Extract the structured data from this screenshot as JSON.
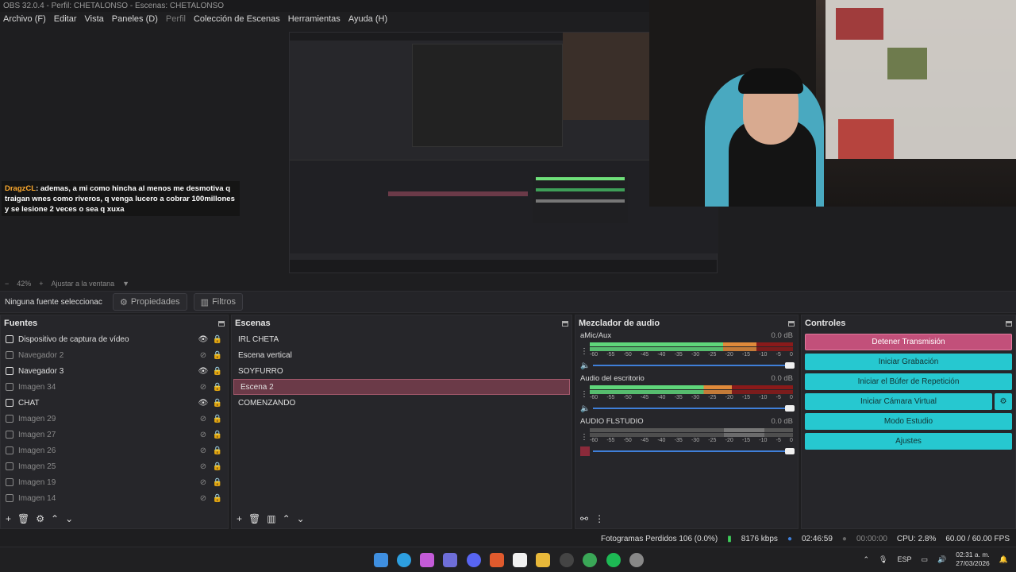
{
  "window": {
    "title": "OBS 32.0.4 - Perfil: CHETALONSO - Escenas: CHETALONSO"
  },
  "menu": [
    {
      "label": "Archivo (F)",
      "dim": false
    },
    {
      "label": "Editar",
      "dim": false
    },
    {
      "label": "Vista",
      "dim": false
    },
    {
      "label": "Paneles (D)",
      "dim": false
    },
    {
      "label": "Perfil",
      "dim": true
    },
    {
      "label": "Colección de Escenas",
      "dim": false
    },
    {
      "label": "Herramientas",
      "dim": false
    },
    {
      "label": "Ayuda (H)",
      "dim": false
    }
  ],
  "chat": {
    "user": "DragzCL",
    "message": ": ademas, a mi como hincha al menos me desmotiva q traigan wnes como riveros, q venga lucero a cobrar 100millones y se lesione 2 veces o sea q xuxa"
  },
  "zoom": {
    "minus": "−",
    "value": "42%",
    "plus": "+",
    "fit": "Ajustar a la ventana"
  },
  "propbar": {
    "no_source": "Ninguna fuente seleccionac",
    "properties": "Propiedades",
    "filters": "Filtros"
  },
  "sources": {
    "title": "Fuentes",
    "items": [
      {
        "name": "Dispositivo de captura de vídeo",
        "visible": true,
        "icon": "camera-icon"
      },
      {
        "name": "Navegador 2",
        "visible": false,
        "icon": "globe-icon"
      },
      {
        "name": "Navegador 3",
        "visible": true,
        "icon": "globe-icon"
      },
      {
        "name": "Imagen 34",
        "visible": false,
        "icon": "image-icon"
      },
      {
        "name": "CHAT",
        "visible": true,
        "icon": "globe-icon"
      },
      {
        "name": "Imagen 29",
        "visible": false,
        "icon": "image-icon"
      },
      {
        "name": "Imagen 27",
        "visible": false,
        "icon": "image-icon"
      },
      {
        "name": "Imagen 26",
        "visible": false,
        "icon": "image-icon"
      },
      {
        "name": "Imagen 25",
        "visible": false,
        "icon": "image-icon"
      },
      {
        "name": "Imagen 19",
        "visible": false,
        "icon": "image-icon"
      },
      {
        "name": "Imagen 14",
        "visible": false,
        "icon": "image-icon"
      }
    ]
  },
  "scenes": {
    "title": "Escenas",
    "items": [
      {
        "name": "IRL CHETA",
        "selected": false
      },
      {
        "name": "Escena vertical",
        "selected": false
      },
      {
        "name": "SOYFURRO",
        "selected": false
      },
      {
        "name": "Escena 2",
        "selected": true
      },
      {
        "name": "COMENZANDO",
        "selected": false
      }
    ]
  },
  "mixer": {
    "title": "Mezclador de audio",
    "ticks": [
      "-60",
      "-55",
      "-50",
      "-45",
      "-40",
      "-35",
      "-30",
      "-25",
      "-20",
      "-15",
      "-10",
      "-5",
      "0"
    ],
    "channels": [
      {
        "name": "aMic/Aux",
        "db": "0.0 dB",
        "level": 0.82,
        "muted": false
      },
      {
        "name": "Audio del escritorio",
        "db": "0.0 dB",
        "level": 0.7,
        "muted": false
      },
      {
        "name": "AUDIO FLSTUDIO",
        "db": "0.0 dB",
        "level": 0.0,
        "muted": true
      }
    ]
  },
  "controls": {
    "title": "Controles",
    "buttons": [
      {
        "label": "Detener Transmisión",
        "style": "stop"
      },
      {
        "label": "Iniciar Grabación",
        "style": "normal"
      },
      {
        "label": "Iniciar el Búfer de Repetición",
        "style": "normal"
      },
      {
        "label": "Iniciar Cámara Virtual",
        "style": "normal"
      },
      {
        "label": "Modo Estudio",
        "style": "normal"
      },
      {
        "label": "Ajustes",
        "style": "normal"
      }
    ]
  },
  "status": {
    "dropped": "Fotogramas Perdidos 106 (0.0%)",
    "bitrate": "8176 kbps",
    "stream_time": "02:46:59",
    "rec_time": "00:00:00",
    "cpu": "CPU: 2.8%",
    "fps": "60.00 / 60.00 FPS"
  },
  "taskbar": {
    "lang": "ESP",
    "time": "02:31 a. m.",
    "date": "27/03/2026"
  },
  "colors": {
    "accent": "#26c8d0",
    "stop": "#c2507a",
    "selected_scene": "#6b3a48"
  }
}
